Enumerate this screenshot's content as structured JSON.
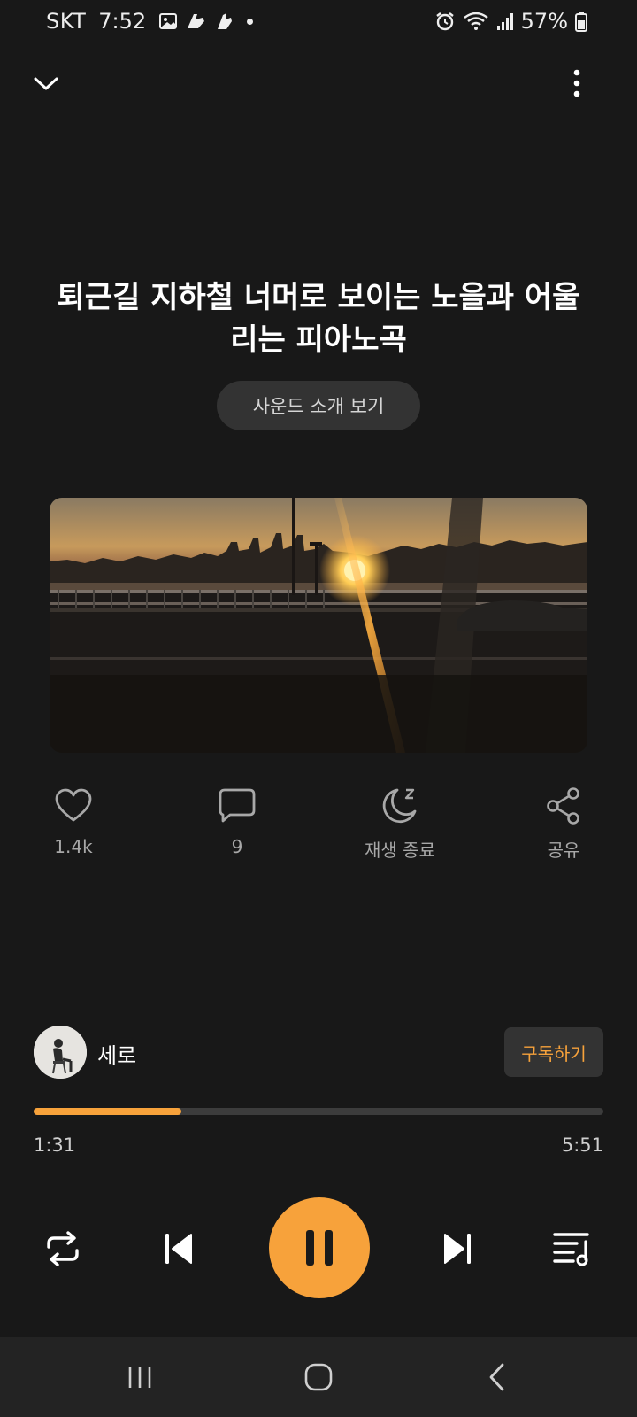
{
  "status_bar": {
    "carrier": "SKT",
    "time": "7:52",
    "battery": "57%",
    "icons": [
      "gallery-icon",
      "app-notification-icon",
      "app-notification-icon",
      "dot-icon",
      "alarm-icon",
      "wifi-icon",
      "signal-icon",
      "battery-icon"
    ]
  },
  "top_bar": {
    "collapse_icon": "chevron-down-icon",
    "more_icon": "more-vertical-icon"
  },
  "track": {
    "title": "퇴근길 지하철 너머로 보이는 노을과 어울리는 피아노곡",
    "intro_button": "사운드 소개 보기",
    "cover_description_icon": "sunset-photo"
  },
  "actions": {
    "like": {
      "icon": "heart-icon",
      "label": "1.4k"
    },
    "comment": {
      "icon": "comment-icon",
      "label": "9"
    },
    "sleep_timer": {
      "icon": "moon-sleep-icon",
      "label": "재생 종료"
    },
    "share": {
      "icon": "share-icon",
      "label": "공유"
    }
  },
  "artist": {
    "name": "세로",
    "subscribe_label": "구독하기"
  },
  "playback": {
    "current_time": "1:31",
    "total_time": "5:51",
    "progress": 0.26
  },
  "controls": {
    "repeat_icon": "repeat-icon",
    "prev_icon": "skip-previous-icon",
    "play_pause_icon": "pause-icon",
    "next_icon": "skip-next-icon",
    "playlist_icon": "playlist-icon"
  },
  "nav_bar": {
    "recents_icon": "recents-icon",
    "home_icon": "home-icon",
    "back_icon": "back-icon"
  },
  "colors": {
    "background": "#181818",
    "accent": "#f7a23b",
    "secondary_text": "#a8a8a8",
    "button_bg": "#333333"
  }
}
